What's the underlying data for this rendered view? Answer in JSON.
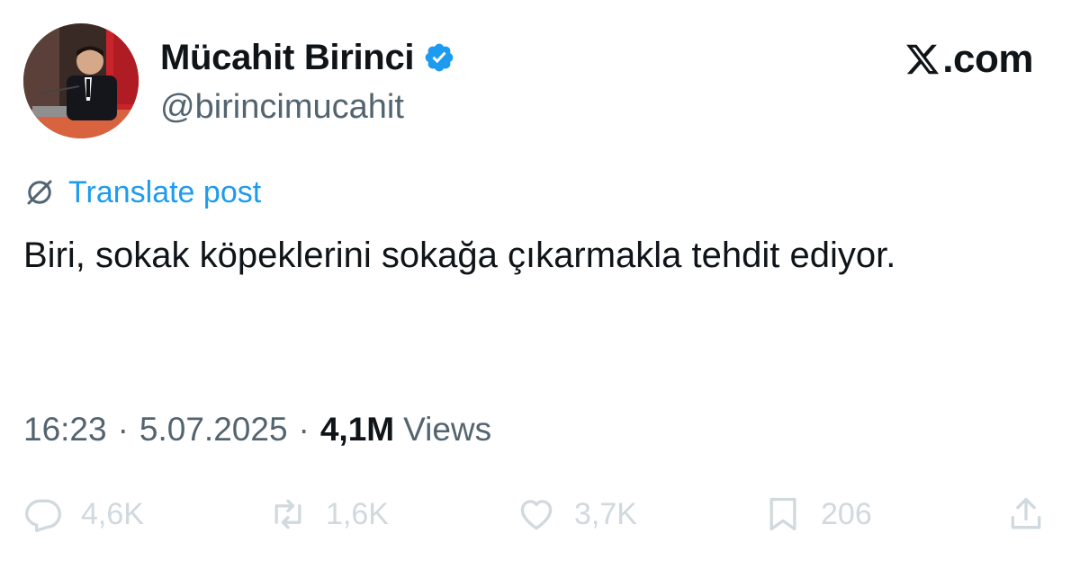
{
  "author": {
    "display_name": "Mücahit Birinci",
    "handle": "@birincimucahit",
    "verified": true,
    "avatar": "avatar-photo"
  },
  "brand": {
    "logo": "x-logo-icon",
    "domain": ".com"
  },
  "translate": {
    "icon": "globe-slash-icon",
    "label": "Translate post"
  },
  "post": {
    "text": "Biri, sokak köpeklerini sokağa çıkarmakla tehdit ediyor."
  },
  "meta": {
    "time": "16:23",
    "separator": "·",
    "date": "5.07.2025",
    "views_count": "4,1M",
    "views_label": "Views"
  },
  "actions": {
    "reply": {
      "icon": "reply-icon",
      "count": "4,6K"
    },
    "repost": {
      "icon": "repost-icon",
      "count": "1,6K"
    },
    "like": {
      "icon": "heart-icon",
      "count": "3,7K"
    },
    "bookmark": {
      "icon": "bookmark-icon",
      "count": "206"
    },
    "share": {
      "icon": "share-icon"
    }
  },
  "colors": {
    "text_primary": "#0f1419",
    "text_secondary": "#536471",
    "accent_blue": "#1d9bf0",
    "action_gray": "#cfd9de"
  }
}
